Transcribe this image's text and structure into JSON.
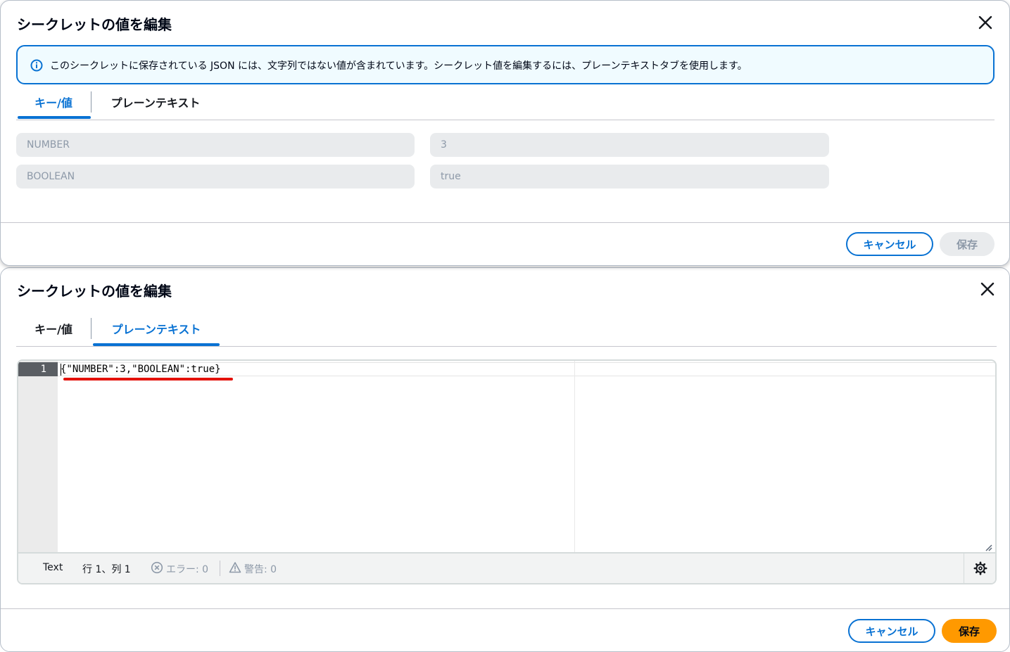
{
  "modal_top": {
    "title": "シークレットの値を編集",
    "alert_text": "このシークレットに保存されている JSON には、文字列ではない値が含まれています。シークレット値を編集するには、プレーンテキストタブを使用します。",
    "tabs": [
      {
        "label": "キー/値",
        "active": true
      },
      {
        "label": "プレーンテキスト",
        "active": false
      }
    ],
    "rows": [
      {
        "key": "NUMBER",
        "value": "3"
      },
      {
        "key": "BOOLEAN",
        "value": "true"
      }
    ],
    "cancel_label": "キャンセル",
    "save_label": "保存",
    "save_enabled": false
  },
  "modal_bottom": {
    "title": "シークレットの値を編集",
    "tabs": [
      {
        "label": "キー/値",
        "active": false
      },
      {
        "label": "プレーンテキスト",
        "active": true
      }
    ],
    "editor": {
      "line_number": "1",
      "code": "{\"NUMBER\":3,\"BOOLEAN\":true}",
      "mode": "Text",
      "position": "行 1、列 1",
      "errors": "エラー: 0",
      "warnings": "警告: 0"
    },
    "cancel_label": "キャンセル",
    "save_label": "保存",
    "save_enabled": true
  },
  "colors": {
    "accent": "#0972d3",
    "primary_button": "#ff9900",
    "disabled": "#e9ebed",
    "annotation_underline": "#e3120b"
  },
  "icons": {
    "close": "close-icon",
    "info": "info-icon",
    "error": "error-circle-icon",
    "warning": "warning-triangle-icon",
    "settings": "gear-icon",
    "resize": "resize-handle-icon"
  }
}
